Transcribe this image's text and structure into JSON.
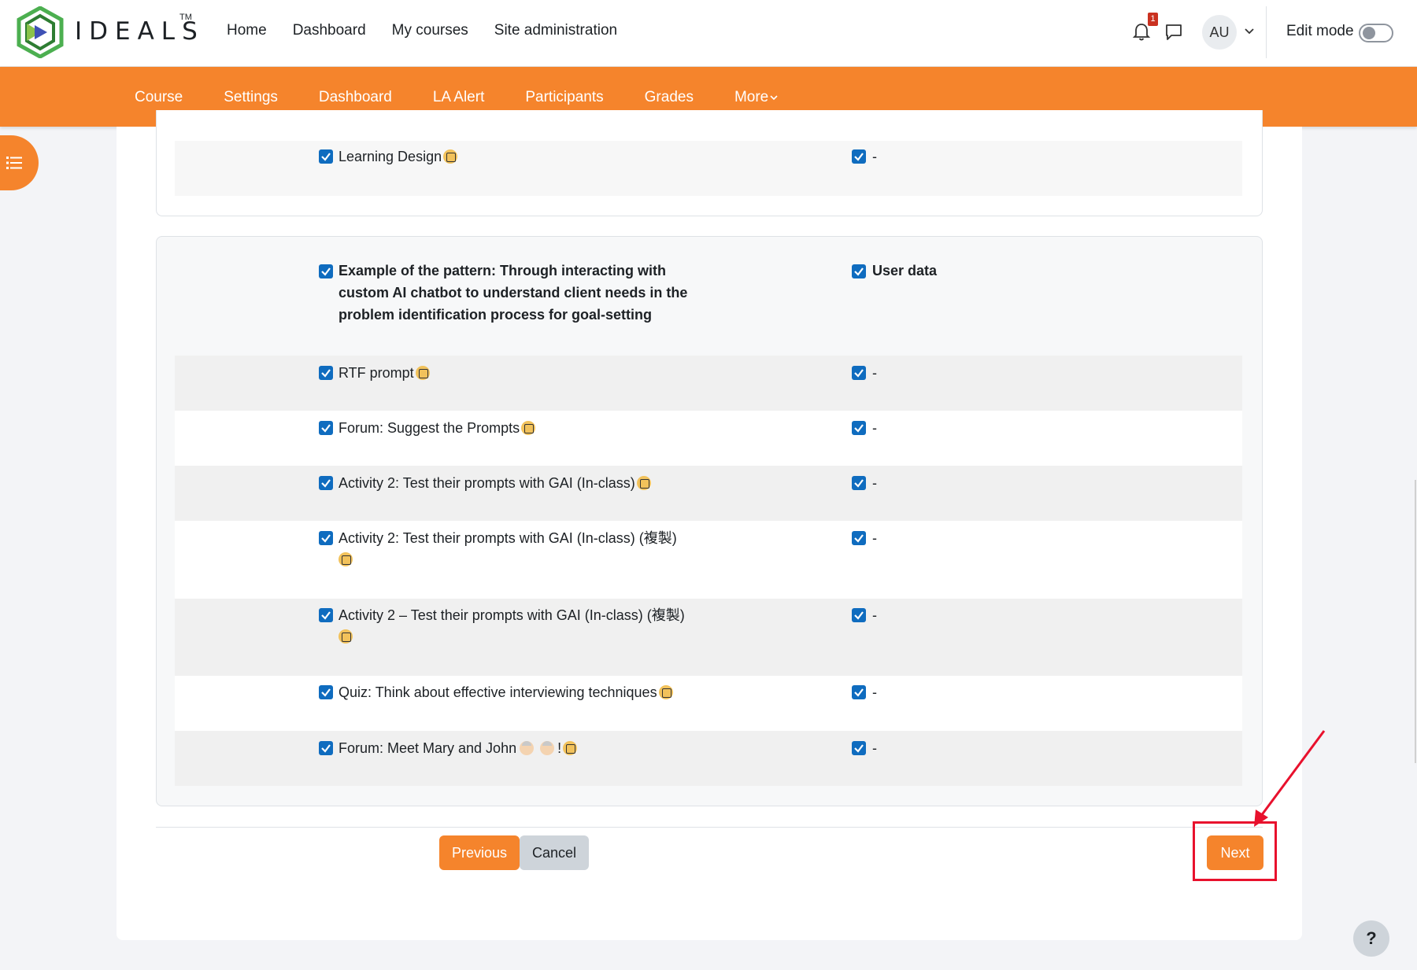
{
  "brand": {
    "name": "IDEALS",
    "tm": "TM"
  },
  "topnav": {
    "items": [
      "Home",
      "Dashboard",
      "My courses",
      "Site administration"
    ]
  },
  "notifications": {
    "count": "1"
  },
  "user": {
    "initials": "AU"
  },
  "edit_mode": {
    "label": "Edit mode",
    "on": false
  },
  "secnav": {
    "items": [
      "Course",
      "Settings",
      "Dashboard",
      "LA Alert",
      "Participants",
      "Grades",
      "More"
    ]
  },
  "section1": {
    "rows": [
      {
        "label": "Learning Design",
        "icon": "lesson-icon",
        "userdata": "-"
      }
    ]
  },
  "section2": {
    "header": {
      "label": "Example of the pattern: Through interacting with custom AI chatbot to understand client needs in the problem identification process for goal-setting",
      "userdata_label": "User data"
    },
    "rows": [
      {
        "label": "RTF prompt",
        "icon": "page-icon",
        "userdata": "-"
      },
      {
        "label": "Forum: Suggest the Prompts",
        "icon": "forum-icon",
        "userdata": "-"
      },
      {
        "label": "Activity 2: Test their prompts with GAI (In-class)",
        "icon": "page-icon",
        "userdata": "-"
      },
      {
        "label": "Activity 2: Test their prompts with GAI (In-class) (複製)",
        "icon": "page-icon",
        "userdata": "-"
      },
      {
        "label": "Activity 2 – Test their prompts with GAI (In-class) (複製)",
        "icon": "page-icon",
        "userdata": "-"
      },
      {
        "label": "Quiz: Think about effective interviewing techniques",
        "icon": "quiz-icon",
        "userdata": "-"
      },
      {
        "label_before": "Forum: Meet Mary and John",
        "label_after": "!",
        "icon": "forum-icon",
        "userdata": "-"
      }
    ]
  },
  "buttons": {
    "previous": "Previous",
    "cancel": "Cancel",
    "next": "Next"
  },
  "help": {
    "label": "?"
  },
  "colors": {
    "accent": "#f5842c",
    "checkbox": "#0f6cbf",
    "annotation": "#e8112d"
  }
}
